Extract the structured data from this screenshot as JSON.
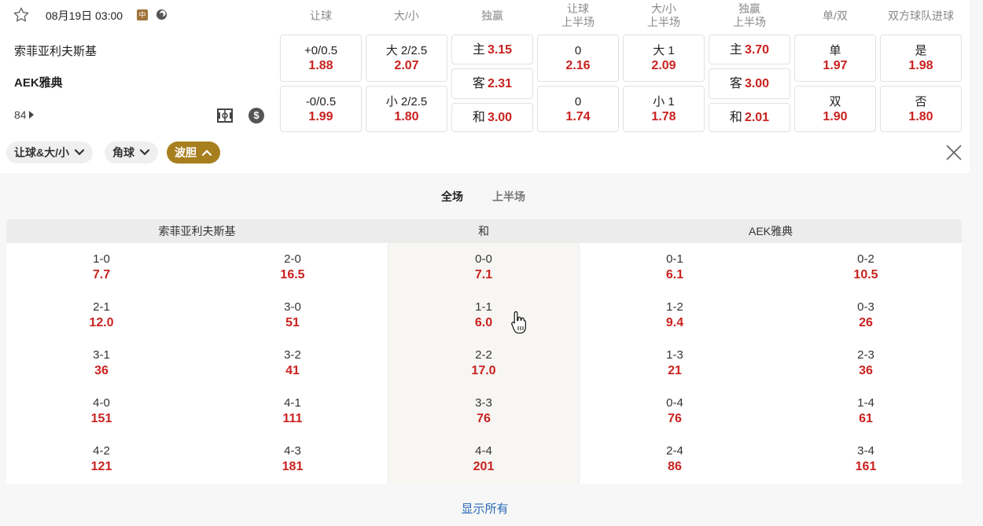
{
  "header": {
    "datetime": "08月19日 03:00",
    "live_badge": "中",
    "columns": [
      "让球",
      "大/小",
      "独赢",
      "让球\n上半场",
      "大/小\n上半场",
      "独赢\n上半场",
      "单/双",
      "双方球队进球"
    ]
  },
  "match": {
    "home": "索菲亚利夫斯基",
    "away": "AEK雅典",
    "minute": "84"
  },
  "odds": {
    "handicap": [
      {
        "label": "+0/0.5",
        "odd": "1.88"
      },
      {
        "label": "-0/0.5",
        "odd": "1.99"
      }
    ],
    "over_under": [
      {
        "label": "大 2/2.5",
        "odd": "2.07"
      },
      {
        "label": "小 2/2.5",
        "odd": "1.80"
      }
    ],
    "moneyline": [
      {
        "label": "主",
        "odd": "3.15"
      },
      {
        "label": "客",
        "odd": "2.31"
      },
      {
        "label": "和",
        "odd": "3.00"
      }
    ],
    "handicap_1h": [
      {
        "label": "0",
        "odd": "2.16"
      },
      {
        "label": "0",
        "odd": "1.74"
      }
    ],
    "over_under_1h": [
      {
        "label": "大 1",
        "odd": "2.09"
      },
      {
        "label": "小 1",
        "odd": "1.78"
      }
    ],
    "moneyline_1h": [
      {
        "label": "主",
        "odd": "3.70"
      },
      {
        "label": "客",
        "odd": "3.00"
      },
      {
        "label": "和",
        "odd": "2.01"
      }
    ],
    "odd_even": [
      {
        "label": "单",
        "odd": "1.97"
      },
      {
        "label": "双",
        "odd": "1.90"
      }
    ],
    "btts": [
      {
        "label": "是",
        "odd": "1.98"
      },
      {
        "label": "否",
        "odd": "1.80"
      }
    ]
  },
  "filters": [
    {
      "label": "让球&大/小",
      "active": false
    },
    {
      "label": "角球",
      "active": false
    },
    {
      "label": "波胆",
      "active": true
    }
  ],
  "subtabs": [
    "全场",
    "上半场"
  ],
  "correct_score": {
    "headers": [
      "索菲亚利夫斯基",
      "和",
      "AEK雅典"
    ],
    "rows": [
      [
        {
          "s": "1-0",
          "o": "7.7"
        },
        {
          "s": "2-0",
          "o": "16.5"
        },
        {
          "s": "0-0",
          "o": "7.1"
        },
        {
          "s": "0-1",
          "o": "6.1"
        },
        {
          "s": "0-2",
          "o": "10.5"
        }
      ],
      [
        {
          "s": "2-1",
          "o": "12.0"
        },
        {
          "s": "3-0",
          "o": "51"
        },
        {
          "s": "1-1",
          "o": "6.0"
        },
        {
          "s": "1-2",
          "o": "9.4"
        },
        {
          "s": "0-3",
          "o": "26"
        }
      ],
      [
        {
          "s": "3-1",
          "o": "36"
        },
        {
          "s": "3-2",
          "o": "41"
        },
        {
          "s": "2-2",
          "o": "17.0"
        },
        {
          "s": "1-3",
          "o": "21"
        },
        {
          "s": "2-3",
          "o": "36"
        }
      ],
      [
        {
          "s": "4-0",
          "o": "151"
        },
        {
          "s": "4-1",
          "o": "111"
        },
        {
          "s": "3-3",
          "o": "76"
        },
        {
          "s": "0-4",
          "o": "76"
        },
        {
          "s": "1-4",
          "o": "61"
        }
      ],
      [
        {
          "s": "4-2",
          "o": "121"
        },
        {
          "s": "4-3",
          "o": "181"
        },
        {
          "s": "4-4",
          "o": "201"
        },
        {
          "s": "2-4",
          "o": "86"
        },
        {
          "s": "3-4",
          "o": "161"
        }
      ]
    ]
  },
  "show_all": "显示所有",
  "colors": {
    "odd_red": "#c9221f",
    "gold": "#a87f1f",
    "link_blue": "#2a69b8"
  }
}
